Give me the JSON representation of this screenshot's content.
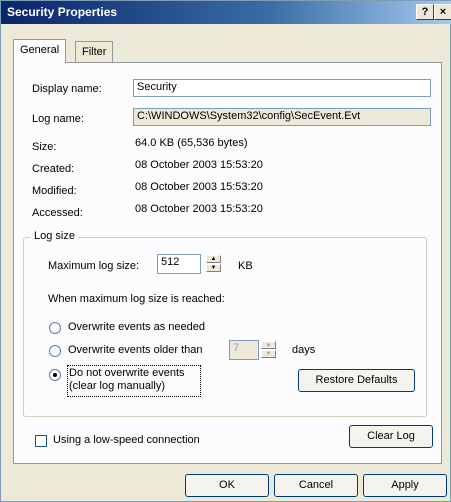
{
  "window": {
    "title": "Security Properties",
    "help_btn": "?",
    "close_btn": "×"
  },
  "tabs": [
    {
      "label": "General"
    },
    {
      "label": "Filter"
    }
  ],
  "general": {
    "display_name_label": "Display name:",
    "display_name_value": "Security",
    "log_name_label": "Log name:",
    "log_name_value": "C:\\WINDOWS\\System32\\config\\SecEvent.Evt",
    "size_label": "Size:",
    "size_value": "64.0 KB (65,536 bytes)",
    "created_label": "Created:",
    "created_value": "08 October 2003 15:53:20",
    "modified_label": "Modified:",
    "modified_value": "08 October 2003 15:53:20",
    "accessed_label": "Accessed:",
    "accessed_value": "08 October 2003 15:53:20"
  },
  "log_size": {
    "group_label": "Log size",
    "max_label": "Maximum log size:",
    "max_value": "512",
    "max_unit": "KB",
    "reached_label": "When maximum log size is reached:",
    "options": [
      {
        "label": "Overwrite events as needed",
        "checked": false
      },
      {
        "label": "Overwrite events older than",
        "checked": false
      },
      {
        "label_line1": "Do not overwrite events",
        "label_line2": "(clear log manually)",
        "checked": true
      }
    ],
    "days_value": "7",
    "days_unit": "days",
    "restore_defaults": "Restore Defaults"
  },
  "low_speed_label": "Using a low-speed connection",
  "clear_log": "Clear Log",
  "footer": {
    "ok": "OK",
    "cancel": "Cancel",
    "apply": "Apply"
  }
}
